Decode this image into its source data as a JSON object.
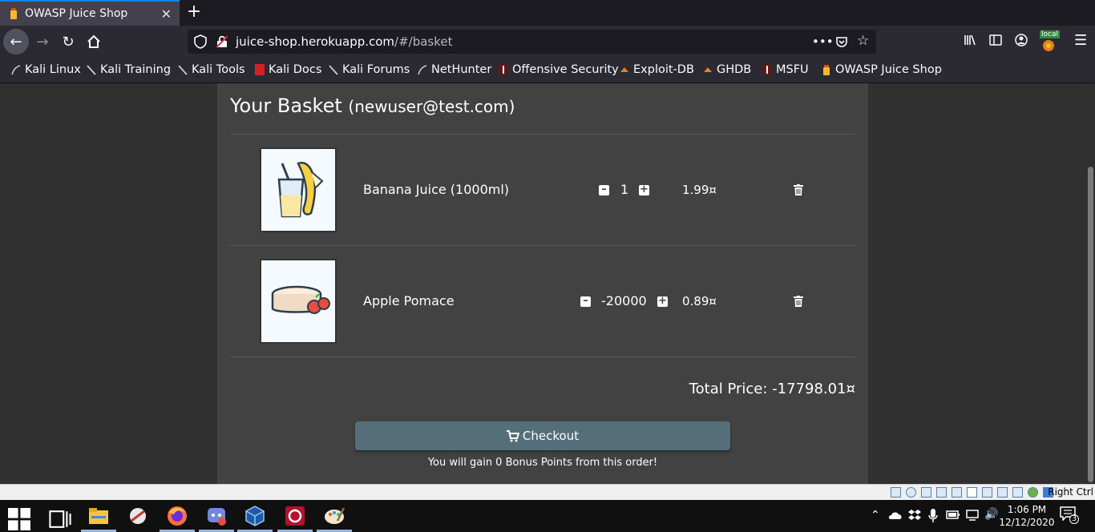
{
  "browser": {
    "tab_title": "OWASP Juice Shop",
    "tab_close": "✕",
    "new_tab": "+",
    "url_host": "juice-shop.herokuapp.com",
    "url_path": "/#/basket",
    "toolbar_badge": "local",
    "bookmarks": [
      {
        "label": "Kali Linux"
      },
      {
        "label": "Kali Training"
      },
      {
        "label": "Kali Tools"
      },
      {
        "label": "Kali Docs"
      },
      {
        "label": "Kali Forums"
      },
      {
        "label": "NetHunter"
      },
      {
        "label": "Offensive Security"
      },
      {
        "label": "Exploit-DB"
      },
      {
        "label": "GHDB"
      },
      {
        "label": "MSFU"
      },
      {
        "label": "OWASP Juice Shop"
      }
    ]
  },
  "basket": {
    "title": "Your Basket",
    "email": "(newuser@test.com)",
    "items": [
      {
        "name": "Banana Juice (1000ml)",
        "quantity": "1",
        "price": "1.99¤"
      },
      {
        "name": "Apple Pomace",
        "quantity": "-20000",
        "price": "0.89¤"
      }
    ],
    "total": "Total Price: -17798.01¤",
    "checkout_label": "Checkout",
    "bonus_text": "You will gain 0 Bonus Points from this order!"
  },
  "vm_status": {
    "host_key": "Right Ctrl"
  },
  "taskbar": {
    "time": "1:06 PM",
    "date": "12/12/2020",
    "notification_count": "3"
  },
  "colors": {
    "accent": "#0a84ff",
    "card": "#424242",
    "checkout": "#546e7a"
  }
}
